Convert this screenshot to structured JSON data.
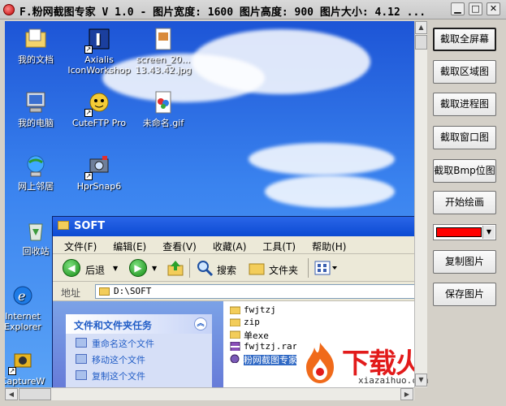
{
  "window": {
    "title": "F.粉网截图专家 V 1.0 - 图片宽度: 1600 图片高度: 900 图片大小: 4.12 ...",
    "min_glyph": "▁",
    "max_glyph": "□",
    "close_glyph": "✕"
  },
  "capture": {
    "desktop_icons": [
      {
        "label": "我的文档",
        "icon": "my-documents-icon"
      },
      {
        "label": "Axialis IconWorkshop",
        "icon": "axialis-icon"
      },
      {
        "label": "screen_20... 13.43.42.jpg",
        "icon": "image-file-icon"
      },
      {
        "label": "我的电脑",
        "icon": "my-computer-icon"
      },
      {
        "label": "CuteFTP Pro",
        "icon": "cuteftp-icon"
      },
      {
        "label": "未命名.gif",
        "icon": "gif-file-icon"
      },
      {
        "label": "网上邻居",
        "icon": "network-icon"
      },
      {
        "label": "HprSnap6",
        "icon": "hprsnap-icon"
      },
      {
        "label": "回收站",
        "icon": "recycle-bin-icon"
      },
      {
        "label": "Internet Explorer",
        "icon": "ie-icon"
      },
      {
        "label": "CaptureW",
        "icon": "capture-icon"
      }
    ],
    "explorer": {
      "title": "SOFT",
      "menu": [
        "文件(F)",
        "编辑(E)",
        "查看(V)",
        "收藏(A)",
        "工具(T)",
        "帮助(H)"
      ],
      "toolbar": {
        "back": "后退",
        "search": "搜索",
        "folders": "文件夹"
      },
      "address_label": "地址",
      "address_value": "D:\\SOFT",
      "task_pane_title": "文件和文件夹任务",
      "tasks": [
        "重命名这个文件",
        "移动这个文件",
        "复制这个文件"
      ],
      "files": [
        {
          "name": "fwjtzj",
          "type": "folder"
        },
        {
          "name": "zip",
          "type": "folder"
        },
        {
          "name": "单exe",
          "type": "folder"
        },
        {
          "name": "fwjtzj.rar",
          "type": "archive"
        },
        {
          "name": "粉网截图专家",
          "type": "app"
        }
      ]
    },
    "watermark": {
      "brand": "下载火",
      "domain": "xiazaihuo.com"
    }
  },
  "side_panel": {
    "buttons": [
      "截取全屏幕",
      "截取区域图",
      "截取进程图",
      "截取窗口图",
      "截取Bmp位图",
      "开始绘画"
    ],
    "buttons_bottom": [
      "复制图片",
      "保存图片"
    ],
    "pen_color": "#ff0000"
  }
}
